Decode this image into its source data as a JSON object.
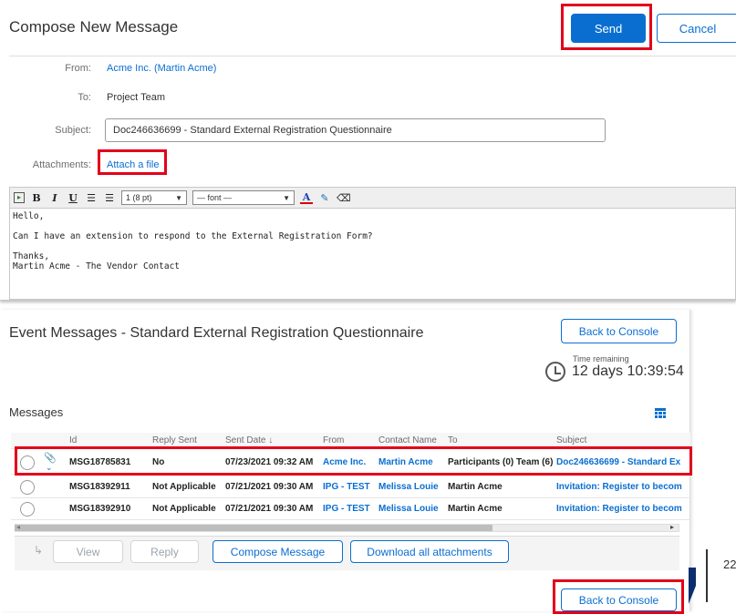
{
  "compose": {
    "title": "Compose New Message",
    "send_label": "Send",
    "cancel_label": "Cancel",
    "from_label": "From:",
    "from_value": "Acme Inc.  (Martin Acme)",
    "to_label": "To:",
    "to_value": "Project Team",
    "subject_label": "Subject:",
    "subject_value": "Doc246636699 - Standard External Registration Questionnaire",
    "attachments_label": "Attachments:",
    "attach_link": "Attach a file",
    "toolbar": {
      "font_size": "1 (8 pt)",
      "font_name": "— font —"
    },
    "body_lines": [
      "Hello,",
      "",
      "Can I have an extension to respond to the External Registration Form?",
      "",
      "Thanks,",
      "Martin Acme - The Vendor Contact"
    ]
  },
  "events": {
    "title": "Event Messages - Standard External Registration Questionnaire",
    "back_to_console": "Back to Console",
    "time_remaining_label": "Time remaining",
    "time_remaining_value": "12 days 10:39:54",
    "messages_label": "Messages",
    "columns": [
      "Id",
      "Reply Sent",
      "Sent Date ↓",
      "From",
      "Contact Name",
      "To",
      "Subject"
    ],
    "rows": [
      {
        "id": "MSG18785831",
        "reply": "No",
        "date": "07/23/2021 09:32 AM",
        "from": "Acme Inc.",
        "contact": "Martin Acme",
        "to": "Participants (0) Team (6)",
        "subject": "Doc246636699 - Standard Ex"
      },
      {
        "id": "MSG18392911",
        "reply": "Not Applicable",
        "date": "07/21/2021 09:30 AM",
        "from": "IPG - TEST",
        "contact": "Melissa Louie",
        "to": "Martin Acme",
        "subject": "Invitation: Register to becom"
      },
      {
        "id": "MSG18392910",
        "reply": "Not Applicable",
        "date": "07/21/2021 09:30 AM",
        "from": "IPG - TEST",
        "contact": "Melissa Louie",
        "to": "Martin Acme",
        "subject": "Invitation: Register to becom"
      }
    ],
    "actions": {
      "view": "View",
      "reply": "Reply",
      "compose": "Compose Message",
      "download": "Download all attachments"
    },
    "back_to_console_bottom": "Back to Console"
  },
  "page_number": "22",
  "colors": {
    "accent": "#0a6ed1",
    "highlight": "#e2001a"
  }
}
